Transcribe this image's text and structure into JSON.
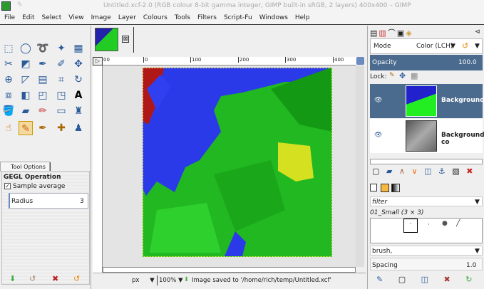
{
  "title": "Untitled.xcf-2.0 (RGB colour 8-bit gamma integer, GIMP built-in sRGB, 2 layers) 400x400 – GIMP",
  "menu": [
    "File",
    "Edit",
    "Select",
    "View",
    "Image",
    "Layer",
    "Colours",
    "Tools",
    "Filters",
    "Script-Fu",
    "Windows",
    "Help"
  ],
  "tool_options": {
    "tab": "Tool Options",
    "heading": "GEGL Operation",
    "sample_average": "Sample average",
    "radius_label": "Radius",
    "radius_value": "3"
  },
  "ruler": {
    "ticks": [
      "0",
      "100",
      "200",
      "300",
      "400"
    ],
    "origin": "00"
  },
  "status": {
    "unit": "px",
    "zoom": "100%",
    "message": "Image saved to '/home/rich/temp/Untitled.xcf'"
  },
  "layers": {
    "mode_label": "Mode",
    "mode_value": "Color (LCH)",
    "opacity_label": "Opacity",
    "opacity_value": "100.0",
    "lock_label": "Lock:",
    "items": [
      {
        "name": "Background",
        "selected": true
      },
      {
        "name": "Background co",
        "selected": false
      }
    ]
  },
  "brushes": {
    "filter_placeholder": "filter",
    "brush_name": "01_Small (3 × 3)",
    "tag_value": "brush,",
    "spacing_label": "Spacing",
    "spacing_value": "1.0"
  },
  "colors": {
    "selection": "#4a6a8e",
    "fg": "#000000",
    "bg": "#ffffff"
  }
}
